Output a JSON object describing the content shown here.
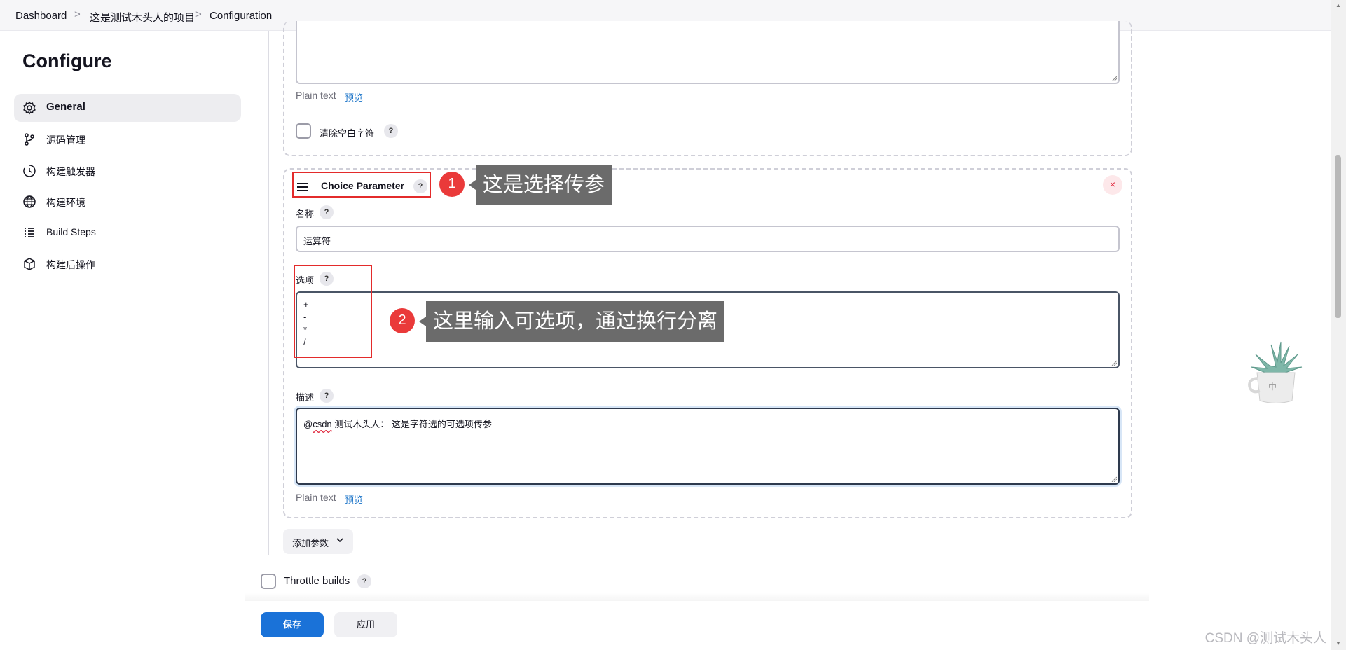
{
  "breadcrumb": {
    "items": [
      "Dashboard",
      "这是测试木头人的项目",
      "Configuration"
    ],
    "separator": ">"
  },
  "sidebar": {
    "title": "Configure",
    "items": [
      {
        "label": "General",
        "icon": "gear-icon",
        "active": true
      },
      {
        "label": "源码管理",
        "icon": "branch-icon",
        "active": false
      },
      {
        "label": "构建触发器",
        "icon": "clock-icon",
        "active": false
      },
      {
        "label": "构建环境",
        "icon": "globe-icon",
        "active": false
      },
      {
        "label": "Build Steps",
        "icon": "list-icon",
        "active": false
      },
      {
        "label": "构建后操作",
        "icon": "cube-icon",
        "active": false
      }
    ]
  },
  "previous_param": {
    "plain_text": "Plain text",
    "preview_link": "预览",
    "trim_label": "清除空白字符",
    "help": "?"
  },
  "choice_param": {
    "title": "Choice Parameter",
    "help": "?",
    "close": "×",
    "name_label": "名称",
    "name_value": "运算符",
    "options_label": "选项",
    "options_value": "+\n-\n*\n/",
    "description_label": "描述",
    "description_prefix": "@",
    "description_squiggle": "csdn",
    "description_rest": " 测试木头人： 这是字符选的可选项传参",
    "plain_text": "Plain text",
    "preview_link": "预览"
  },
  "annotations": [
    {
      "number": "1",
      "text": "这是选择传参"
    },
    {
      "number": "2",
      "text": "这里输入可选项，通过换行分离"
    }
  ],
  "add_param_label": "添加参数",
  "throttle_label": "Throttle builds",
  "buttons": {
    "save": "保存",
    "apply": "应用"
  },
  "widget_text": "中",
  "watermark": "CSDN @测试木头人",
  "colors": {
    "primary": "#1a72d8",
    "annotation_red": "#e32b2b",
    "callout_bg": "#6b6b6b"
  }
}
